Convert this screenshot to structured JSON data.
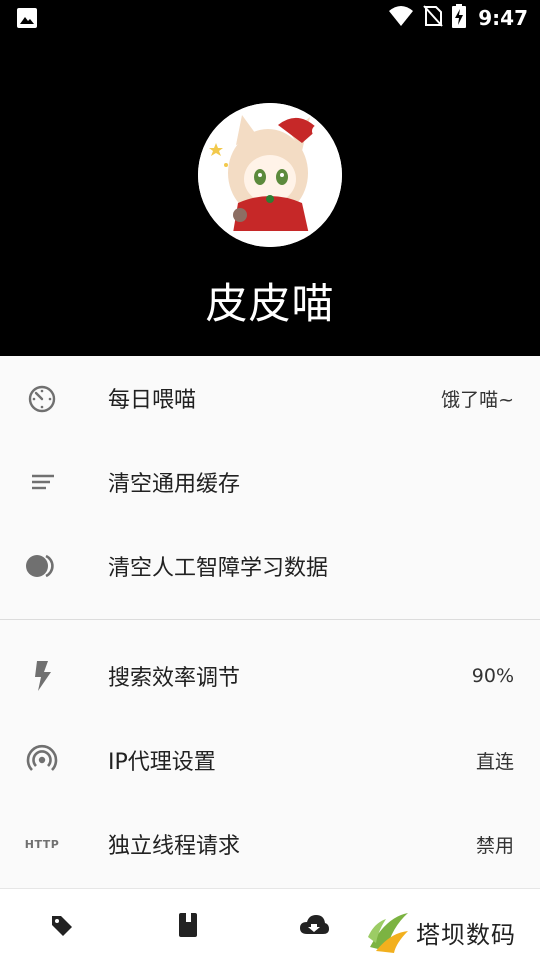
{
  "status_bar": {
    "time": "9:47",
    "icons": [
      "image-icon",
      "wifi-icon",
      "no-sim-icon",
      "battery-charging-icon"
    ]
  },
  "profile": {
    "username": "皮皮喵",
    "avatar": "avatar-anime-cat-girl"
  },
  "settings": {
    "items": [
      {
        "icon": "timer-icon",
        "label": "每日喂喵",
        "value": "饿了喵~"
      },
      {
        "icon": "clear-lines-icon",
        "label": "清空通用缓存",
        "value": ""
      },
      {
        "icon": "toggle-icon",
        "label": "清空人工智障学习数据",
        "value": ""
      },
      {
        "icon": "flash-icon",
        "label": "搜索效率调节",
        "value": "90%"
      },
      {
        "icon": "wifi-tethering-icon",
        "label": "IP代理设置",
        "value": "直连"
      },
      {
        "icon": "http-icon",
        "label": "独立线程请求",
        "value": "禁用"
      }
    ],
    "http_icon_text": "HTTP"
  },
  "bottom_nav": {
    "items": [
      "tag-icon",
      "book-icon",
      "cloud-download-icon"
    ]
  },
  "watermark": {
    "text": "塔坝数码"
  }
}
